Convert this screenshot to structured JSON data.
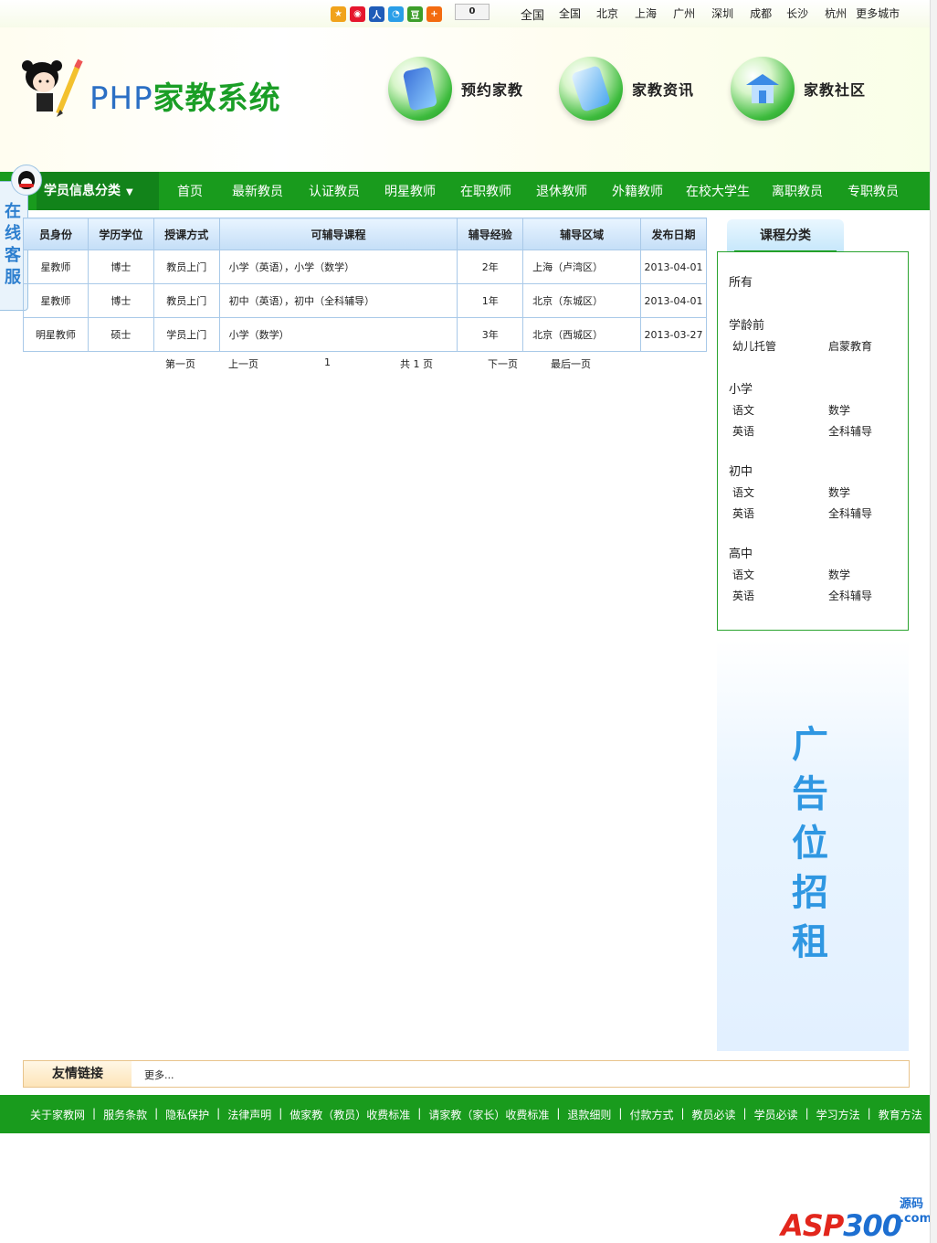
{
  "topbar": {
    "share_count": "0",
    "cities": [
      "全国",
      "全国",
      "北京",
      "上海",
      "广州",
      "深圳",
      "成都",
      "长沙",
      "杭州",
      "更多城市"
    ]
  },
  "header": {
    "logo_php": "PHP",
    "logo_rest": "家教系统",
    "nav": [
      {
        "label": "预约家教",
        "icon": "phone-icon"
      },
      {
        "label": "家教资讯",
        "icon": "document-icon"
      },
      {
        "label": "家教社区",
        "icon": "house-icon"
      }
    ]
  },
  "mainnav": {
    "category_label": "学员信息分类",
    "links": [
      "首页",
      "最新教员",
      "认证教员",
      "明星教师",
      "在职教师",
      "退休教师",
      "外籍教师",
      "在校大学生",
      "离职教员",
      "专职教员"
    ]
  },
  "service": {
    "label": "在线客服"
  },
  "listing": {
    "headers": [
      "员身份",
      "学历学位",
      "授课方式",
      "可辅导课程",
      "辅导经验",
      "辅导区域",
      "发布日期"
    ],
    "rows": [
      [
        "星教师",
        "博士",
        "教员上门",
        "小学（英语），小学（数学）",
        "2年",
        "上海（卢湾区）",
        "2013-04-01"
      ],
      [
        "星教师",
        "博士",
        "教员上门",
        "初中（英语），初中（全科辅导）",
        "1年",
        "北京（东城区）",
        "2013-04-01"
      ],
      [
        "明星教师",
        "硕士",
        "学员上门",
        "小学（数学）",
        "3年",
        "北京（西城区）",
        "2013-03-27"
      ]
    ],
    "pager": {
      "first": "第一页",
      "prev": "上一页",
      "current": "1",
      "total": "共 1 页",
      "next": "下一页",
      "last": "最后一页"
    }
  },
  "sidebar": {
    "title": "课程分类",
    "all": "所有",
    "groups": [
      {
        "name": "学龄前",
        "items": [
          "幼儿托管",
          "启蒙教育"
        ]
      },
      {
        "name": "小学",
        "items": [
          "语文",
          "数学",
          "英语",
          "全科辅导"
        ]
      },
      {
        "name": "初中",
        "items": [
          "语文",
          "数学",
          "英语",
          "全科辅导"
        ]
      },
      {
        "name": "高中",
        "items": [
          "语文",
          "数学",
          "英语",
          "全科辅导"
        ]
      }
    ],
    "ad_text": "广告位招租"
  },
  "links": {
    "title": "友情链接",
    "more": "更多..."
  },
  "footer": {
    "links": [
      "关于家教网",
      "服务条款",
      "隐私保护",
      "法律声明",
      "做家教（教员）收费标准",
      "请家教（家长）收费标准",
      "退款细则",
      "付款方式",
      "教员必读",
      "学员必读",
      "学习方法",
      "教育方法"
    ]
  },
  "watermark": {
    "main_a": "ASP",
    "main_b": "300",
    "side_a": "源码",
    "side_b": ".com"
  },
  "colors": {
    "green": "#199b1d",
    "blue": "#2f97e2",
    "border_blue": "#a9c9e8"
  }
}
